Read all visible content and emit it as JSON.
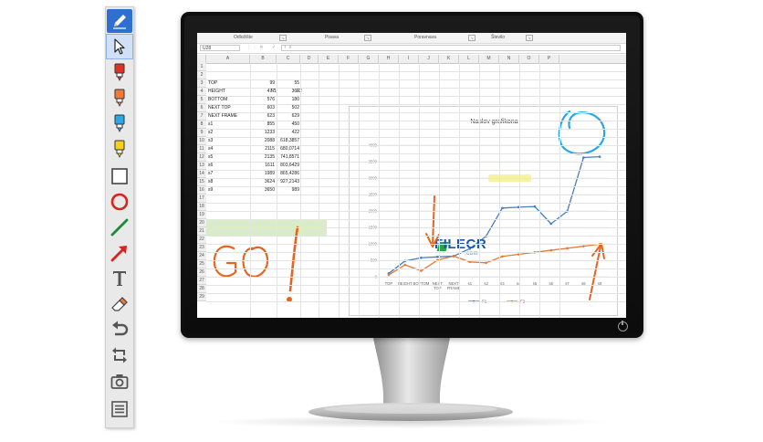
{
  "toolbar": {
    "tools": [
      {
        "name": "pen-tool",
        "icon": "pencil-icon"
      },
      {
        "name": "select-tool",
        "icon": "cursor-arrow-icon"
      },
      {
        "name": "marker-red",
        "icon": "red-marker-icon",
        "color": "#e0302a"
      },
      {
        "name": "marker-orange",
        "icon": "orange-marker-icon",
        "color": "#f07a3a"
      },
      {
        "name": "marker-blue",
        "icon": "blue-marker-icon",
        "color": "#2aa7e8"
      },
      {
        "name": "marker-yellow",
        "icon": "yellow-marker-icon",
        "color": "#f2d21b"
      },
      {
        "name": "rectangle-tool",
        "icon": "rectangle-icon"
      },
      {
        "name": "circle-tool",
        "icon": "circle-icon"
      },
      {
        "name": "line-tool",
        "icon": "line-icon"
      },
      {
        "name": "arrow-tool",
        "icon": "arrow-icon"
      },
      {
        "name": "text-tool",
        "icon": "text-icon"
      },
      {
        "name": "eraser-tool",
        "icon": "eraser-icon"
      },
      {
        "name": "undo-tool",
        "icon": "undo-icon"
      },
      {
        "name": "swap-tool",
        "icon": "swap-icon"
      },
      {
        "name": "screenshot-tool",
        "icon": "camera-icon"
      },
      {
        "name": "menu-tool",
        "icon": "menu-icon"
      }
    ]
  },
  "spreadsheet": {
    "ribbon_groups": [
      "Odložište",
      "Pisava",
      "Poravnava",
      "Število"
    ],
    "name_box": "U28",
    "fx_icons": "⋮ ✕ ✓ fx",
    "columns": [
      "A",
      "B",
      "C",
      "D",
      "E",
      "F",
      "G",
      "H",
      "I",
      "J",
      "K",
      "L",
      "M",
      "N",
      "O",
      "P"
    ],
    "rows": [
      "1",
      "2",
      "3",
      "4",
      "5",
      "6",
      "7",
      "8",
      "9",
      "10",
      "11",
      "12",
      "13",
      "14",
      "15",
      "16",
      "17",
      "18",
      "19",
      "20",
      "21",
      "22",
      "23",
      "24",
      "25",
      "26",
      "27",
      "28",
      "29"
    ],
    "header_f1": "F1",
    "header_f2": "F2",
    "data_rows": [
      {
        "label": "TOP",
        "f1": "99",
        "f2": "55"
      },
      {
        "label": "HEIGHT",
        "f1": "477",
        "f2": "360"
      },
      {
        "label": "BOTTOM",
        "f1": "576",
        "f2": "180"
      },
      {
        "label": "NEXT TOP",
        "f1": "603",
        "f2": "502"
      },
      {
        "label": "NEXT FRAME",
        "f1": "623",
        "f2": "629"
      },
      {
        "label": "s1",
        "f1": "855",
        "f2": "450"
      },
      {
        "label": "s2",
        "f1": "1233",
        "f2": "422"
      },
      {
        "label": "s3",
        "f1": "2088",
        "f2": "618,3857"
      },
      {
        "label": "s4",
        "f1": "2115",
        "f2": "680,0714"
      },
      {
        "label": "s5",
        "f1": "2135",
        "f2": "741,8571"
      },
      {
        "label": "s6",
        "f1": "1611",
        "f2": "803,6429"
      },
      {
        "label": "s7",
        "f1": "1989",
        "f2": "865,4286"
      },
      {
        "label": "s8",
        "f1": "3624",
        "f2": "927,2143"
      },
      {
        "label": "s9",
        "f1": "3650",
        "f2": "989"
      }
    ]
  },
  "chart_data": {
    "type": "line",
    "title": "Naslov grafikona",
    "categories": [
      "TOP",
      "HEIGHT",
      "BOTTOM",
      "NEXT TOP",
      "NEXT FRAME",
      "s1",
      "s2",
      "s3",
      "s4",
      "s5",
      "s6",
      "s7",
      "s8",
      "s9"
    ],
    "category_labels": [
      [
        "TOP"
      ],
      [
        "HEIGHT"
      ],
      [
        "BOTTOM"
      ],
      [
        "NEXT",
        "TOP"
      ],
      [
        "NEXT",
        "FRAME"
      ],
      [
        "s1"
      ],
      [
        "s2"
      ],
      [
        "s3"
      ],
      [
        "s4"
      ],
      [
        "s5"
      ],
      [
        "s6"
      ],
      [
        "s7"
      ],
      [
        "s8"
      ],
      [
        "s9"
      ]
    ],
    "series": [
      {
        "name": "F1",
        "color": "#4a7ebb",
        "values": [
          99,
          477,
          576,
          603,
          623,
          855,
          1233,
          2088,
          2115,
          2135,
          1611,
          1989,
          3624,
          3650
        ]
      },
      {
        "name": "F2",
        "color": "#e07b39",
        "values": [
          55,
          360,
          180,
          502,
          629,
          450,
          422,
          618.3857,
          680.0714,
          741.8571,
          803.6429,
          865.4286,
          927.2143,
          989
        ]
      }
    ],
    "yticks": [
      "0",
      "500",
      "1000",
      "1500",
      "2000",
      "2500",
      "3000",
      "3500",
      "4000"
    ],
    "ylim": [
      0,
      4000
    ],
    "grid": true,
    "legend": "bottom"
  },
  "annotations": {
    "go_text": "GO!",
    "go_color": "#e8641e",
    "arrow_color": "#e8641e",
    "circle_color": "#27a8e0",
    "highlight_color": "#f6ee8a"
  },
  "watermark": {
    "text": "FILECR",
    "suffix": ".com"
  }
}
